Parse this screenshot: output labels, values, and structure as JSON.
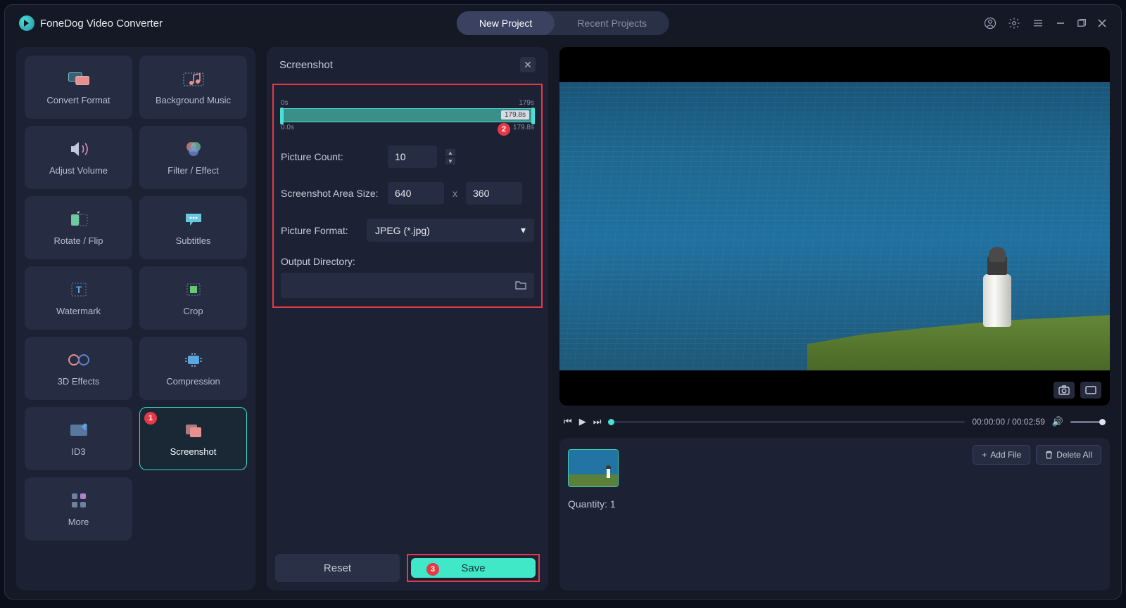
{
  "app": {
    "title": "FoneDog Video Converter"
  },
  "tabs": {
    "new": "New Project",
    "recent": "Recent Projects"
  },
  "sidebar": {
    "items": [
      {
        "label": "Convert Format"
      },
      {
        "label": "Background Music"
      },
      {
        "label": "Adjust Volume"
      },
      {
        "label": "Filter / Effect"
      },
      {
        "label": "Rotate / Flip"
      },
      {
        "label": "Subtitles"
      },
      {
        "label": "Watermark"
      },
      {
        "label": "Crop"
      },
      {
        "label": "3D Effects"
      },
      {
        "label": "Compression"
      },
      {
        "label": "ID3"
      },
      {
        "label": "Screenshot"
      },
      {
        "label": "More"
      }
    ]
  },
  "panel": {
    "title": "Screenshot",
    "range": {
      "start_top": "0s",
      "end_top": "179s",
      "tag": "179.8s",
      "start_bottom": "0.0s",
      "end_bottom": "179.8s"
    },
    "picture_count": {
      "label": "Picture Count:",
      "value": "10"
    },
    "area_size": {
      "label": "Screenshot Area Size:",
      "width": "640",
      "sep": "x",
      "height": "360"
    },
    "format": {
      "label": "Picture Format:",
      "value": "JPEG (*.jpg)"
    },
    "outdir": {
      "label": "Output Directory:"
    },
    "reset": "Reset",
    "save": "Save"
  },
  "player": {
    "time": "00:00:00 / 00:02:59"
  },
  "filelist": {
    "add": "Add File",
    "delete": "Delete All",
    "quantity_label": "Quantity:",
    "quantity_value": "1"
  },
  "badges": {
    "b1": "1",
    "b2": "2",
    "b3": "3"
  }
}
